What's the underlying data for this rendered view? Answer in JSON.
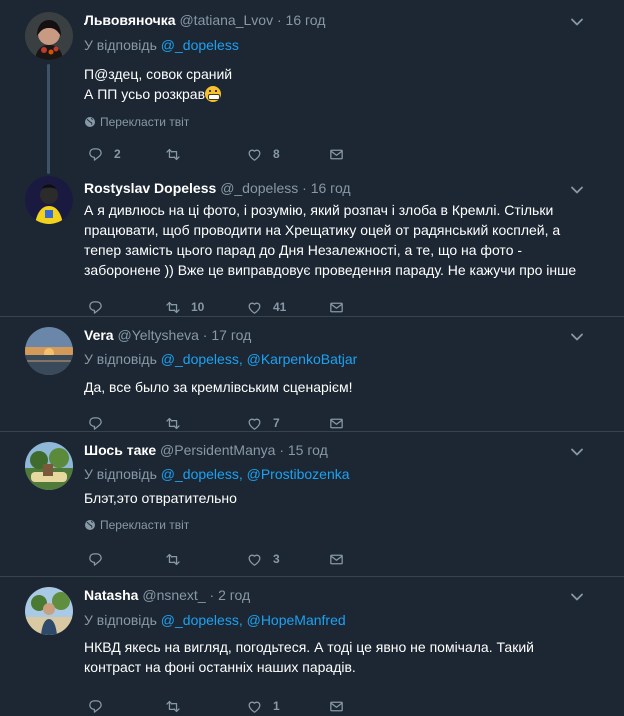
{
  "reply_prefix": "У відповідь",
  "translate_label": "Перекласти твіт",
  "tweets": [
    {
      "name": "Львовяночка",
      "handle": "@tatiana_Lvov",
      "time": "16 год",
      "mentions": [
        "@_dopeless"
      ],
      "text_lines": [
        "П@здец, совок сраний",
        "А ПП усьо розкрав"
      ],
      "replies": "2",
      "retweets": "",
      "likes": "8"
    },
    {
      "name": "Rostyslav Dopeless",
      "handle": "@_dopeless",
      "time": "16 год",
      "text_lines": [
        "А я дивлюсь на ці фото, і розумію, який розпач і злоба в Кремлі. Стільки",
        "працювати, щоб проводити на Хрещатику оцей от радянський косплей, а",
        "тепер замість цього парад до Дня Незалежності, а те, що на фото -",
        "заборонене )) Вже це виправдовує проведення параду. Не кажучи про інше"
      ],
      "replies": "",
      "retweets": "10",
      "likes": "41"
    },
    {
      "name": "Vera",
      "handle": "@Yeltysheva",
      "time": "17 год",
      "mentions": [
        "@_dopeless",
        "@KarpenkoBatjar"
      ],
      "text_lines": [
        "Да, все было за кремлівським сценарієм!"
      ],
      "replies": "",
      "retweets": "",
      "likes": "7"
    },
    {
      "name": "Шось таке",
      "handle": "@PersidentManya",
      "time": "15 год",
      "mentions": [
        "@_dopeless",
        "@Prostibozenka"
      ],
      "text_lines": [
        "Блэт,это отвратительно"
      ],
      "replies": "",
      "retweets": "",
      "likes": "3"
    },
    {
      "name": "Natasha",
      "handle": "@nsnext_",
      "time": "2 год",
      "mentions": [
        "@_dopeless",
        "@HopeManfred"
      ],
      "text_lines": [
        "НКВД якесь на вигляд, погодьтеся. А тоді це явно не помічала. Такий",
        "контраст на фоні останніх наших парадів."
      ],
      "replies": "",
      "retweets": "",
      "likes": "1"
    }
  ],
  "colors": {
    "background": "#1c2733",
    "separator": "#38444d",
    "secondary_text": "#8899a6",
    "link": "#1da1f2"
  }
}
